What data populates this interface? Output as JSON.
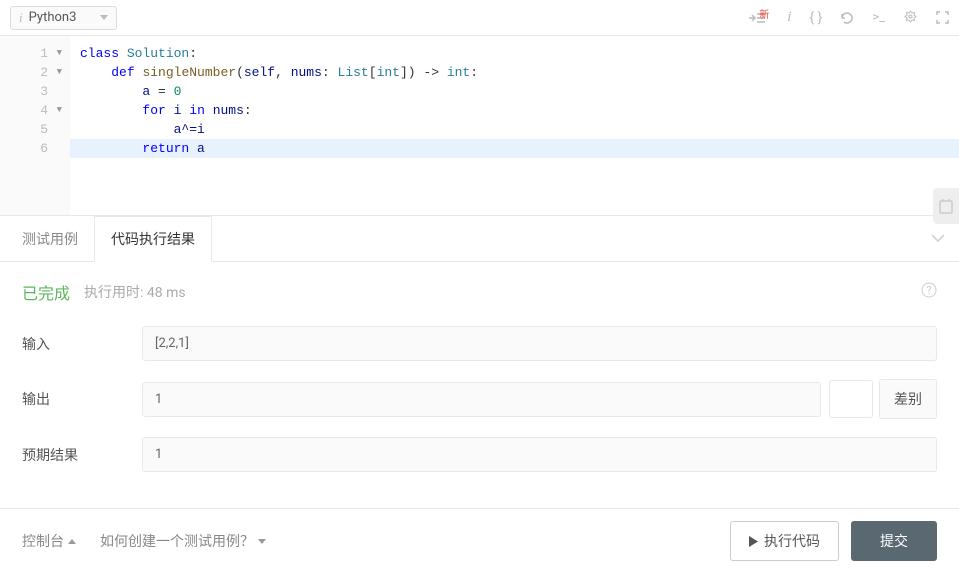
{
  "toolbar": {
    "language": "Python3",
    "new_badge": "新"
  },
  "code": {
    "lines": [
      {
        "n": 1,
        "fold": true
      },
      {
        "n": 2,
        "fold": true
      },
      {
        "n": 3,
        "fold": false
      },
      {
        "n": 4,
        "fold": true
      },
      {
        "n": 5,
        "fold": false
      },
      {
        "n": 6,
        "fold": false
      }
    ],
    "tokens": {
      "class": "class",
      "solution": "Solution",
      "colon": ":",
      "def": "def",
      "singleNumber": "singleNumber",
      "lparen": "(",
      "self": "self",
      "comma": ", ",
      "nums": "nums",
      "colon2": ": ",
      "list": "List",
      "lbrack": "[",
      "int": "int",
      "rbrack": "]",
      "rparen": ")",
      "arrow": " -> ",
      "int2": "int",
      "colon3": ":",
      "a": "a",
      "eq": " = ",
      "zero": "0",
      "for": "for",
      "i": "i",
      "in": "in",
      "nums2": "nums",
      "colon4": ":",
      "axor": "a^=i",
      "return": "return",
      "a2": "a"
    }
  },
  "tabs": {
    "testcases": "测试用例",
    "results": "代码执行结果"
  },
  "result": {
    "status": "已完成",
    "runtime_label": "执行用时: 48 ms",
    "input_label": "输入",
    "input_value": "[2,2,1]",
    "output_label": "输出",
    "output_value": "1",
    "diff_label": "差别",
    "expected_label": "预期结果",
    "expected_value": "1"
  },
  "footer": {
    "console": "控制台",
    "howto": "如何创建一个测试用例？",
    "run": "执行代码",
    "submit": "提交"
  }
}
